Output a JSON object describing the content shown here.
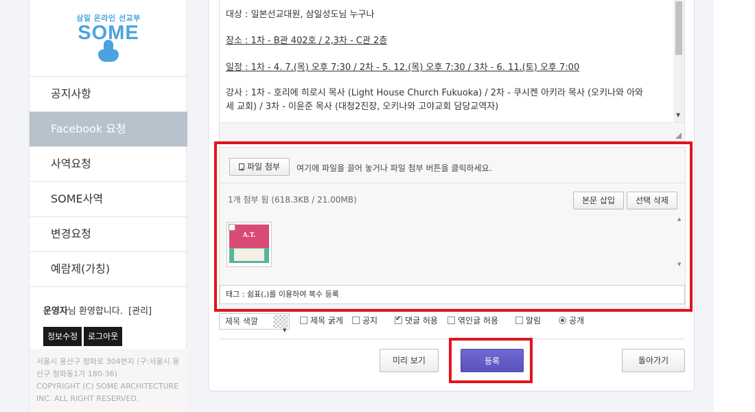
{
  "logo": {
    "subtitle": "삼일 온라인 선교부",
    "title": "SOME"
  },
  "nav": {
    "items": [
      {
        "label": "공지사항"
      },
      {
        "label": "Facebook 요청",
        "active": true
      },
      {
        "label": "사역요청"
      },
      {
        "label": "SOME사역"
      },
      {
        "label": "변경요청"
      },
      {
        "label": "예람제(가칭)"
      }
    ]
  },
  "user": {
    "name": "운영자",
    "greeting": "님 환영합니다.",
    "admin_link": "[관리]",
    "edit_info": "정보수정",
    "logout": "로그아웃"
  },
  "footer": {
    "address": "서울시 용산구 청파로 304번지 (구:서울시 용산구 청파동1가 180-36)",
    "copyright": "COPYRIGHT (C) SOME ARCHITECTURE INC. ALL RIGHT RESERVED."
  },
  "editor": {
    "lines": [
      {
        "text": "대상 : 일본선교대원, 삼일성도님 누구나",
        "underline": false
      },
      {
        "text": "장소 : 1차 - B관 402호 / 2,3차 - C관 2층 ",
        "underline": true
      },
      {
        "text": "일정 : 1차 - 4. 7.(목) 오후 7:30 / 2차 - 5. 12.(목) 오후 7:30 / 3차 - 6. 11.(토) 오후 7:00 ",
        "underline": true
      },
      {
        "text": "강사 : 1차 - 호리에 히로시 목사 (Light House Church Fukuoka) / 2차 - 쿠시켄 아키라 목사 (오키나와 아와",
        "underline": false
      },
      {
        "text": "세 교회) / 3차 - 이윤준 목사 (대청2진장, 오키나와 고야교회 담당교역자)",
        "underline": false
      }
    ]
  },
  "attach": {
    "file_button": "파일 첨부",
    "drop_hint": "여기에 파일을 끌어 놓거나 파일 첨부 버튼을 클릭하세요.",
    "count_text": "1개 첨부 됨 (618.3KB / 21.00MB)",
    "insert_button": "본문 삽입",
    "delete_button": "선택 삭제",
    "thumbnail_text": "A.T.",
    "tag_placeholder": "태그 : 쉼표(,)를 이용하여 복수 등록"
  },
  "options": {
    "title_color_label": "제목 색깔",
    "items": [
      {
        "label": "제목 굵게",
        "type": "checkbox",
        "checked": false
      },
      {
        "label": "공지",
        "type": "checkbox",
        "checked": false
      },
      {
        "label": "댓글 허용",
        "type": "checkbox",
        "checked": true
      },
      {
        "label": "엮인글 허용",
        "type": "checkbox",
        "checked": false
      },
      {
        "label": "알림",
        "type": "checkbox",
        "checked": false
      },
      {
        "label": "공개",
        "type": "radio",
        "checked": true
      }
    ]
  },
  "actions": {
    "preview": "미리 보기",
    "submit": "등록",
    "back": "돌아가기"
  },
  "colors": {
    "accent": "#5a52bf",
    "nav_active": "#b8c2cc",
    "annotation": "#e3121c",
    "brand": "#4aa3df"
  }
}
